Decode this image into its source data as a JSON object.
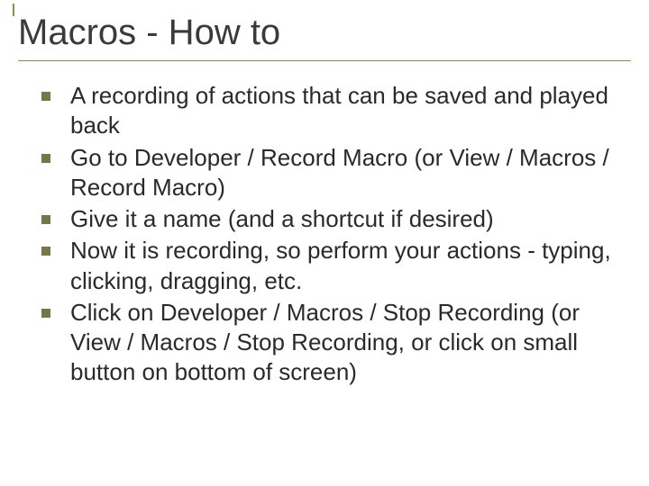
{
  "title": "Macros - How to",
  "bullets": [
    "A recording of actions that can be saved and played back",
    "Go to Developer / Record Macro (or View / Macros / Record Macro)",
    "Give it a name (and a shortcut if desired)",
    "Now it is recording, so perform your actions - typing, clicking, dragging, etc.",
    "Click on Developer / Macros / Stop Recording (or View / Macros / Stop Recording, or click on small button on bottom of screen)"
  ]
}
